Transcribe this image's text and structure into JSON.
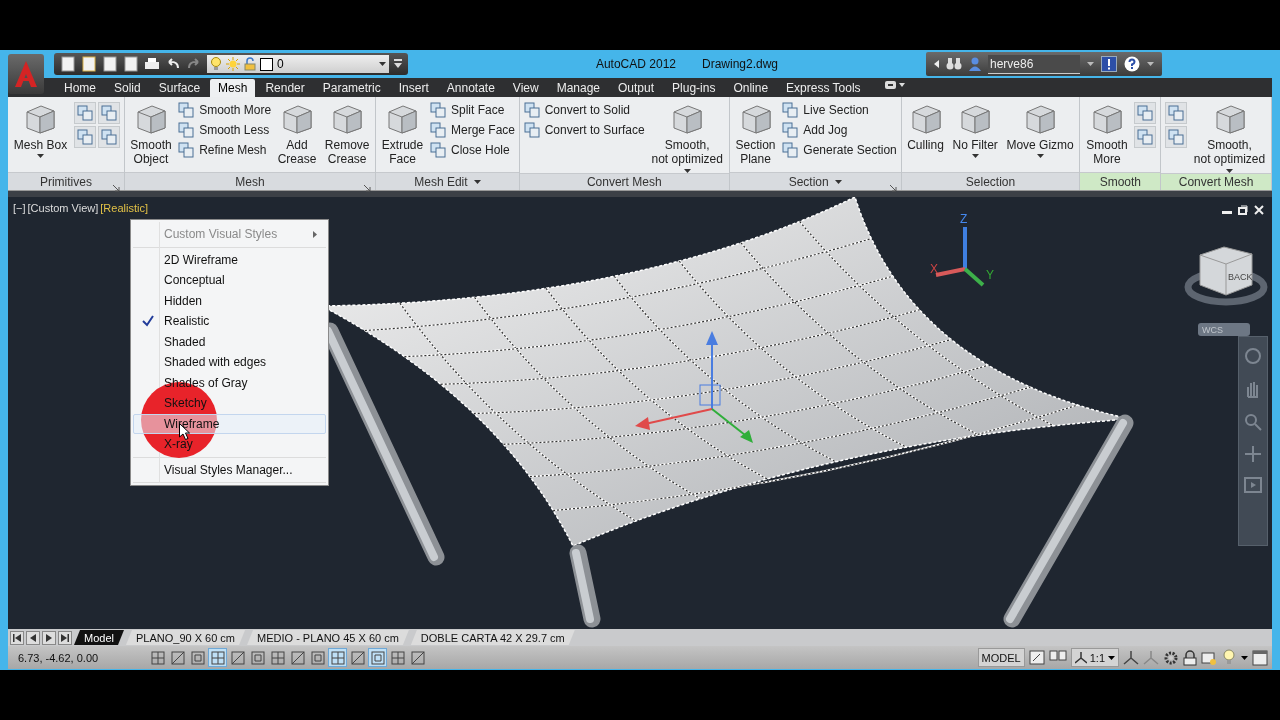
{
  "title_bar": {
    "layer": "0",
    "app_name": "AutoCAD 2012",
    "file_name": "Drawing2.dwg",
    "user": "herve86"
  },
  "ribbon_tabs": [
    {
      "label": "Home",
      "selected": false
    },
    {
      "label": "Solid",
      "selected": false
    },
    {
      "label": "Surface",
      "selected": false
    },
    {
      "label": "Mesh",
      "selected": true
    },
    {
      "label": "Render",
      "selected": false
    },
    {
      "label": "Parametric",
      "selected": false
    },
    {
      "label": "Insert",
      "selected": false
    },
    {
      "label": "Annotate",
      "selected": false
    },
    {
      "label": "View",
      "selected": false
    },
    {
      "label": "Manage",
      "selected": false
    },
    {
      "label": "Output",
      "selected": false
    },
    {
      "label": "Plug-ins",
      "selected": false
    },
    {
      "label": "Online",
      "selected": false
    },
    {
      "label": "Express Tools",
      "selected": false
    }
  ],
  "ribbon_panels": [
    {
      "title": "Primitives",
      "contextual": false,
      "launcher": true,
      "dropdown": false,
      "tools": [
        {
          "kind": "large",
          "label": "Mesh Box",
          "dropdown": true
        },
        {
          "kind": "icon"
        },
        {
          "kind": "icon"
        },
        {
          "kind": "icon"
        },
        {
          "kind": "icon"
        }
      ]
    },
    {
      "title": "Mesh",
      "contextual": false,
      "launcher": true,
      "dropdown": false,
      "tools": [
        {
          "kind": "large",
          "label": "Smooth\nObject",
          "dropdown": false
        },
        {
          "kind": "small",
          "label": "Smooth More"
        },
        {
          "kind": "small",
          "label": "Smooth Less"
        },
        {
          "kind": "small",
          "label": "Refine Mesh"
        },
        {
          "kind": "large",
          "label": "Add\nCrease",
          "dropdown": false
        },
        {
          "kind": "large",
          "label": "Remove\nCrease",
          "dropdown": false
        }
      ]
    },
    {
      "title": "Mesh Edit",
      "contextual": false,
      "launcher": false,
      "dropdown": true,
      "tools": [
        {
          "kind": "large",
          "label": "Extrude\nFace",
          "dropdown": false
        },
        {
          "kind": "small",
          "label": "Split Face"
        },
        {
          "kind": "small",
          "label": "Merge Face"
        },
        {
          "kind": "small",
          "label": "Close Hole"
        }
      ]
    },
    {
      "title": "Convert Mesh",
      "contextual": false,
      "launcher": false,
      "dropdown": false,
      "tools": [
        {
          "kind": "small",
          "label": "Convert to Solid"
        },
        {
          "kind": "small",
          "label": "Convert to Surface"
        },
        {
          "kind": "large",
          "label": "Smooth,\nnot optimized",
          "dropdown": true
        }
      ]
    },
    {
      "title": "Section",
      "contextual": false,
      "launcher": true,
      "dropdown": true,
      "tools": [
        {
          "kind": "large",
          "label": "Section\nPlane",
          "dropdown": false
        },
        {
          "kind": "small",
          "label": "Live Section"
        },
        {
          "kind": "small",
          "label": "Add Jog"
        },
        {
          "kind": "small",
          "label": "Generate Section"
        }
      ]
    },
    {
      "title": "Selection",
      "contextual": false,
      "launcher": false,
      "dropdown": false,
      "tools": [
        {
          "kind": "large",
          "label": "Culling",
          "dropdown": false
        },
        {
          "kind": "large",
          "label": "No Filter",
          "dropdown": true
        },
        {
          "kind": "large",
          "label": "Move Gizmo",
          "dropdown": true
        }
      ]
    },
    {
      "title": "Smooth",
      "contextual": true,
      "launcher": false,
      "dropdown": false,
      "tools": [
        {
          "kind": "large",
          "label": "Smooth\nMore",
          "dropdown": false
        },
        {
          "kind": "icon"
        },
        {
          "kind": "icon"
        }
      ]
    },
    {
      "title": "Convert Mesh",
      "contextual": true,
      "launcher": false,
      "dropdown": false,
      "tools": [
        {
          "kind": "icon"
        },
        {
          "kind": "icon"
        },
        {
          "kind": "large",
          "label": "Smooth,\nnot optimized",
          "dropdown": true
        }
      ]
    }
  ],
  "viewport": {
    "controls": [
      {
        "label": "[−]",
        "kind": "plain"
      },
      {
        "label": "[Custom View]",
        "kind": "plain"
      },
      {
        "label": "[Realistic]",
        "kind": "style"
      }
    ],
    "ucs_labels": [
      "X",
      "Y",
      "Z"
    ],
    "viewcube_face": "BACK",
    "ucs_menu": "WCS"
  },
  "context_menu": {
    "sections": [
      [
        {
          "label": "Custom Visual Styles",
          "submenu": true,
          "disabled": true,
          "checked": false,
          "highlighted": false
        }
      ],
      [
        {
          "label": "2D Wireframe",
          "submenu": false,
          "disabled": false,
          "checked": false,
          "highlighted": false
        },
        {
          "label": "Conceptual",
          "submenu": false,
          "disabled": false,
          "checked": false,
          "highlighted": false
        },
        {
          "label": "Hidden",
          "submenu": false,
          "disabled": false,
          "checked": false,
          "highlighted": false
        },
        {
          "label": "Realistic",
          "submenu": false,
          "disabled": false,
          "checked": true,
          "highlighted": false
        },
        {
          "label": "Shaded",
          "submenu": false,
          "disabled": false,
          "checked": false,
          "highlighted": false
        },
        {
          "label": "Shaded with edges",
          "submenu": false,
          "disabled": false,
          "checked": false,
          "highlighted": false
        },
        {
          "label": "Shades of Gray",
          "submenu": false,
          "disabled": false,
          "checked": false,
          "highlighted": false
        },
        {
          "label": "Sketchy",
          "submenu": false,
          "disabled": false,
          "checked": false,
          "highlighted": false
        },
        {
          "label": "Wireframe",
          "submenu": false,
          "disabled": false,
          "checked": false,
          "highlighted": true
        },
        {
          "label": "X-ray",
          "submenu": false,
          "disabled": false,
          "checked": false,
          "highlighted": false
        }
      ],
      [
        {
          "label": "Visual Styles Manager...",
          "submenu": false,
          "disabled": false,
          "checked": false,
          "highlighted": false
        }
      ]
    ]
  },
  "layout_tabs": [
    {
      "label": "Model",
      "selected": true
    },
    {
      "label": "PLANO_90 X 60 cm",
      "selected": false
    },
    {
      "label": "MEDIO - PLANO 45 X 60 cm",
      "selected": false
    },
    {
      "label": "DOBLE CARTA 42 X 29.7 cm",
      "selected": false
    }
  ],
  "status_bar": {
    "coordinates": "6.73, -4.62, 0.00",
    "toggles": [
      {
        "on": false
      },
      {
        "on": false
      },
      {
        "on": false
      },
      {
        "on": true
      },
      {
        "on": false
      },
      {
        "on": false
      },
      {
        "on": false
      },
      {
        "on": false
      },
      {
        "on": false
      },
      {
        "on": true
      },
      {
        "on": false
      },
      {
        "on": true
      },
      {
        "on": false
      },
      {
        "on": false
      }
    ],
    "space": "MODEL",
    "annotation_scale": "1:1"
  }
}
